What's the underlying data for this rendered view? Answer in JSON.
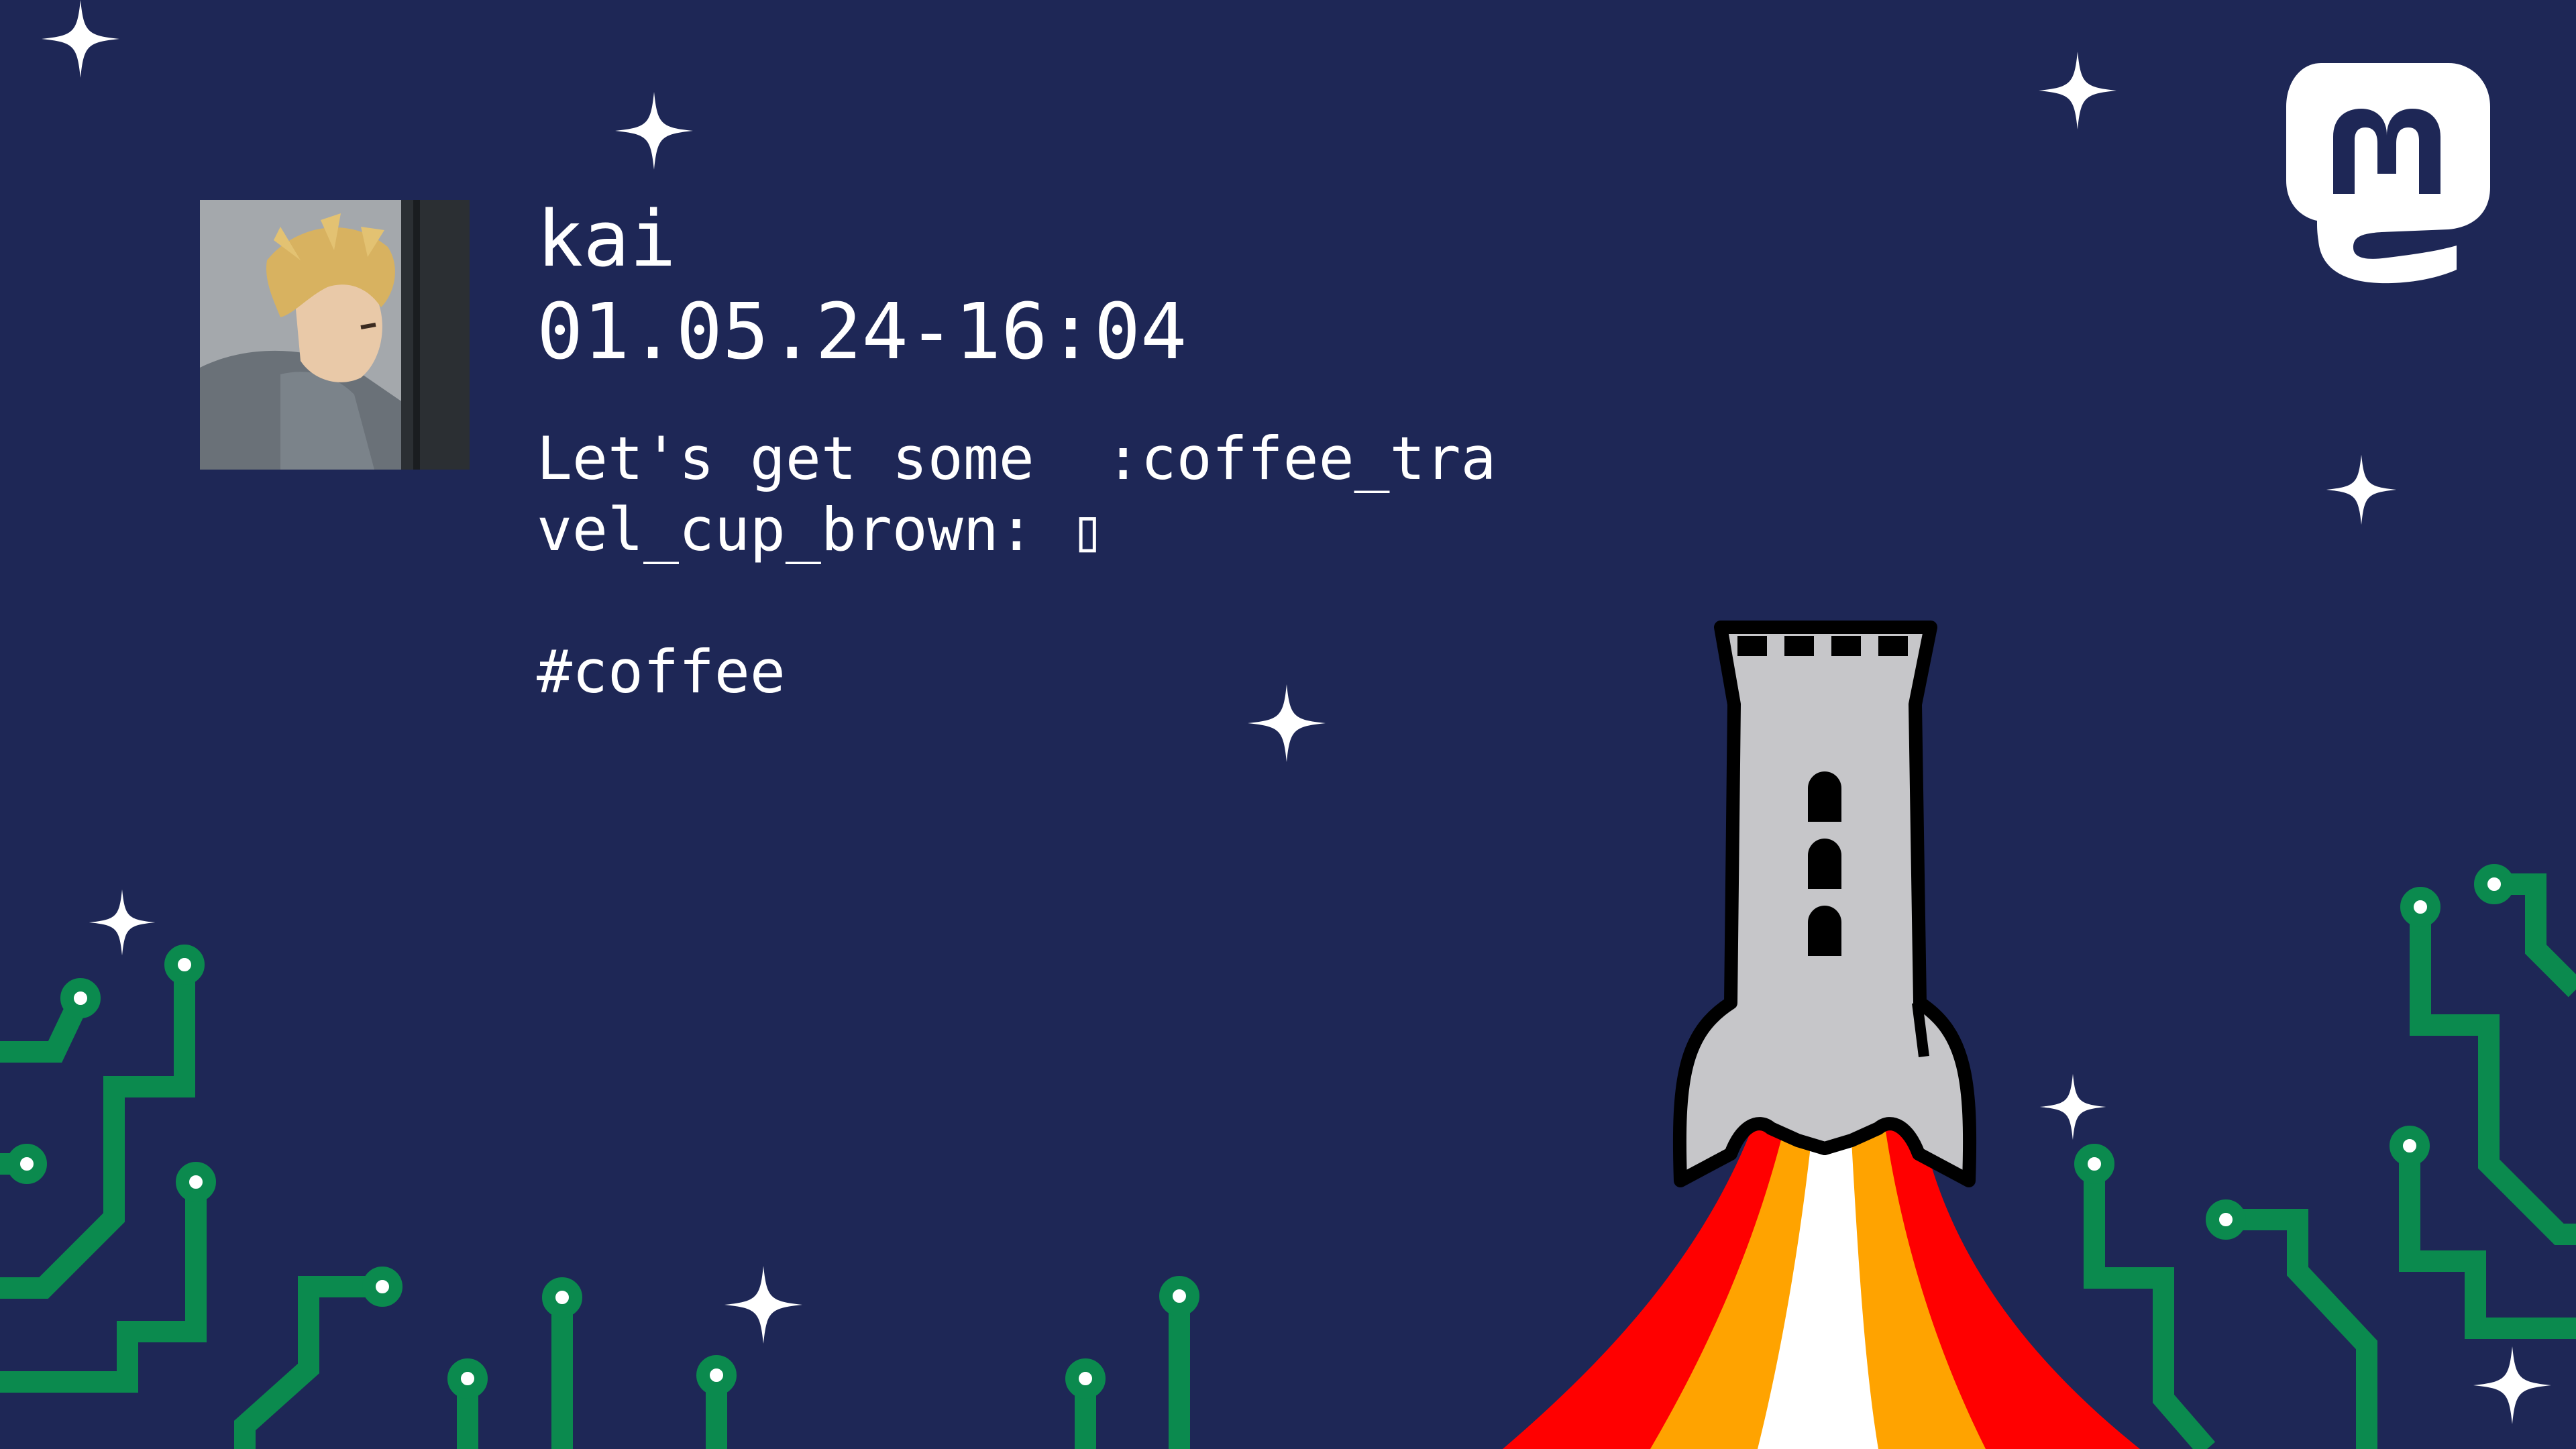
{
  "post": {
    "username": "kai",
    "timestamp": "01.05.24-16:04",
    "content": "Let's get some  :coffee_travel_cup_brown: ▯",
    "hashtag": "#coffee"
  },
  "icons": {
    "avatar": "avatar-anime-character",
    "brand": "mastodon-logo-icon",
    "illustration": "rocket-tower-icon"
  },
  "colors": {
    "background": "#1e2756",
    "text": "#ffffff",
    "circuit": "#0b8a4e",
    "rocket_body": "#c6c6c9",
    "flame_red": "#ff0000",
    "flame_orange": "#ffa300",
    "flame_white": "#ffffff"
  }
}
